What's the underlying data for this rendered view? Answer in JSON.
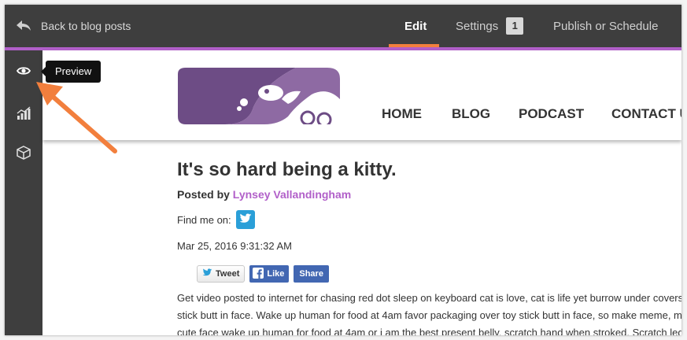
{
  "topbar": {
    "back_label": "Back to blog posts",
    "tabs": {
      "edit": "Edit",
      "settings": "Settings",
      "settings_badge": "1",
      "publish": "Publish or Schedule"
    }
  },
  "sidebar": {
    "items": [
      {
        "icon": "eye-icon",
        "name": "preview"
      },
      {
        "icon": "chart-icon",
        "name": "analytics"
      },
      {
        "icon": "box-icon",
        "name": "modules"
      }
    ],
    "tooltip": "Preview"
  },
  "site": {
    "nav": [
      "HOME",
      "BLOG",
      "PODCAST",
      "CONTACT U"
    ]
  },
  "post": {
    "title": "It's so hard being a kitty.",
    "posted_by": "Posted by",
    "author": "Lynsey Vallandingham",
    "find_me": "Find me on:",
    "date": "Mar 25, 2016 9:31:32 AM",
    "share": {
      "tweet": "Tweet",
      "like": "Like",
      "share": "Share"
    },
    "body_lines": [
      "Get video posted to internet for chasing red dot sleep on keyboard cat is love, cat is life yet burrow under covers",
      "stick butt in face. Wake up human for food at 4am favor packaging over toy stick butt in face, so make meme, m",
      "cute face wake up human for food at 4am or i am the best present belly, scratch hand when stroked. Scratch leg"
    ]
  },
  "colors": {
    "topbar": "#3e3e3e",
    "accent_purple": "#b15fc9",
    "accent_orange": "#f27f3d",
    "author_link": "#b15fc9",
    "twitter": "#2a9fd8",
    "facebook": "#4267b2",
    "logo_purple": "#6d4c85"
  }
}
